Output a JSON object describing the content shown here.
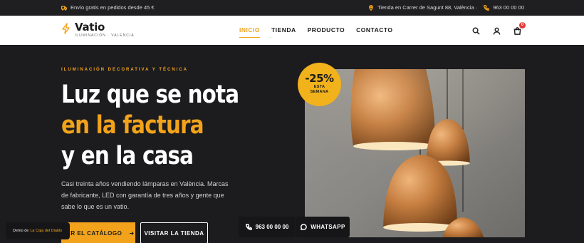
{
  "topbar": {
    "shipping": "Envío gratis en pedidos desde 45 €",
    "store": "Tienda en Carrer de Sagunt 88, València ·",
    "phone": "963 00 00 00"
  },
  "header": {
    "logo_name": "Vatio",
    "logo_sub": "ILUMINACIÓN · VALENCIA",
    "nav": [
      "INICIO",
      "TIENDA",
      "PRODUCTO",
      "CONTACTO"
    ],
    "active_nav": "INICIO",
    "cart_count": "0"
  },
  "hero": {
    "eyebrow": "ILUMINACIÓN DECORATIVA Y TÉCNICA",
    "line1": "Luz que se nota",
    "line2": "en la factura",
    "line3": "y en la casa",
    "description": "Casi treinta años vendiendo lámparas en València. Marcas de fabricante, LED con garantía de tres años y gente que sabe lo que es un vatio.",
    "primary_button": "VER EL CATÁLOGO",
    "secondary_button": "VISITAR LA TIENDA"
  },
  "promo": {
    "percent": "-25%",
    "line1": "ESTA",
    "line2": "SEMANA"
  },
  "floating": {
    "phone": "963 00 00 00",
    "whatsapp": "WHATSAPP"
  },
  "demo": {
    "prefix": "Demo de",
    "link": "La Caja del Diablo"
  },
  "colors": {
    "accent": "#f2a31b",
    "dark_bg": "#1c1c1f",
    "header_bg": "#ffffff"
  }
}
